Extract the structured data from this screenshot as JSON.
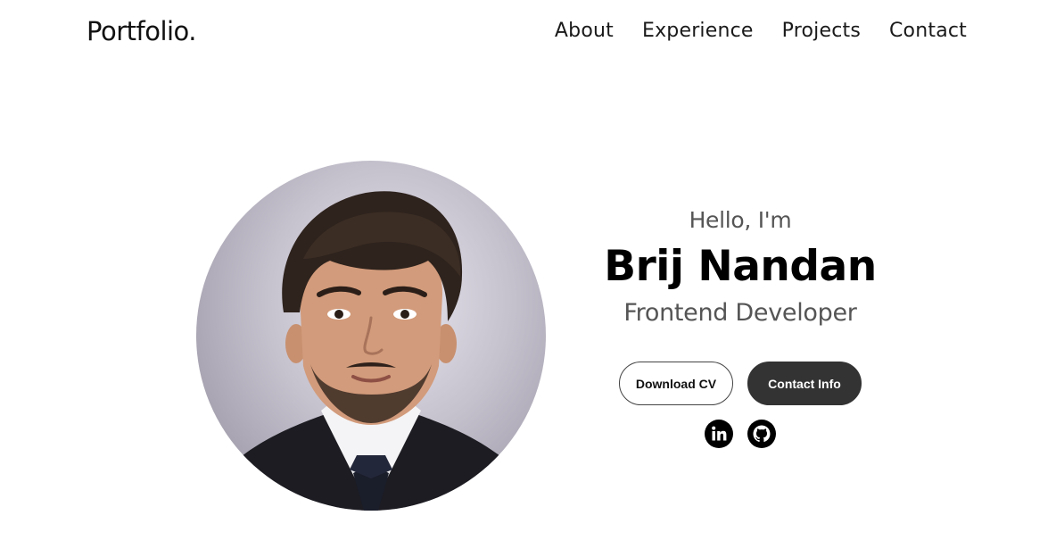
{
  "header": {
    "logo": "Portfolio.",
    "nav": [
      {
        "label": "About"
      },
      {
        "label": "Experience"
      },
      {
        "label": "Projects"
      },
      {
        "label": "Contact"
      }
    ]
  },
  "hero": {
    "greeting": "Hello, I'm",
    "name": "Brij Nandan",
    "title": "Frontend Developer",
    "buttons": {
      "download": "Download CV",
      "contact": "Contact Info"
    },
    "socials": [
      {
        "icon": "linkedin-icon"
      },
      {
        "icon": "github-icon"
      }
    ]
  },
  "colors": {
    "text_primary": "#000000",
    "text_secondary": "#555555",
    "button_dark": "#333333",
    "background": "#ffffff"
  }
}
